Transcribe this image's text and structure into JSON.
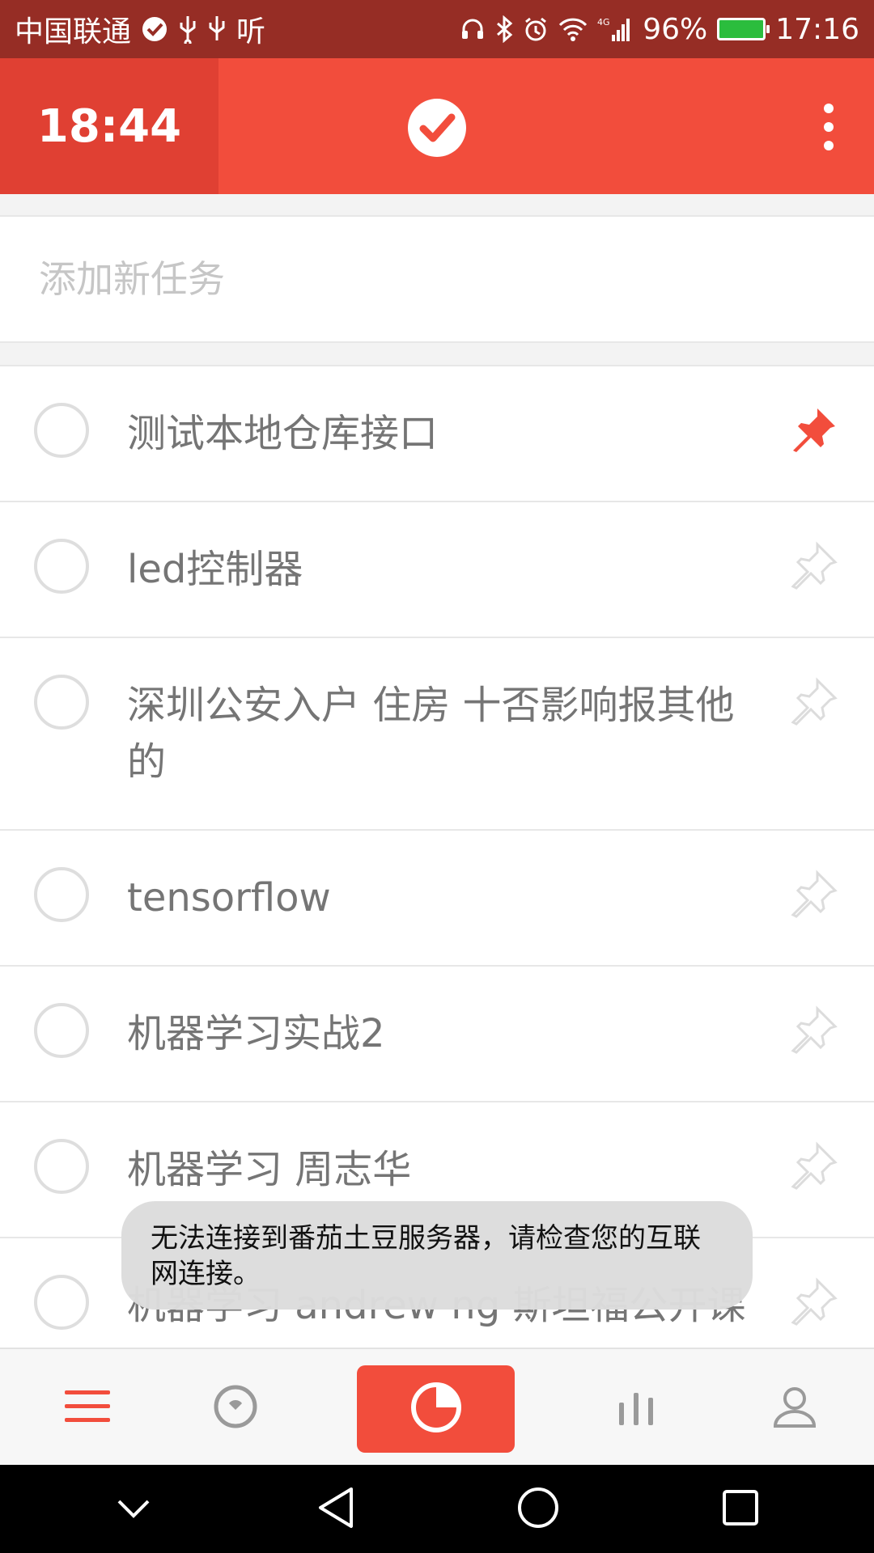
{
  "status_bar": {
    "carrier": "中国联通",
    "listen_label": "听",
    "network_type": "4G",
    "battery_percent": "96%",
    "time": "17:16"
  },
  "app_bar": {
    "timer": "18:44"
  },
  "add_task": {
    "placeholder": "添加新任务"
  },
  "tasks": [
    {
      "title": "测试本地仓库接口",
      "pinned": true
    },
    {
      "title": "led控制器",
      "pinned": false
    },
    {
      "title": "深圳公安入户 住房  十否影响报其他的",
      "pinned": false
    },
    {
      "title": "tensorflow",
      "pinned": false
    },
    {
      "title": "机器学习实战2",
      "pinned": false
    },
    {
      "title": "机器学习 周志华",
      "pinned": false
    },
    {
      "title": "机器学习 andrew ng 斯坦福公开课",
      "pinned": false
    }
  ],
  "toast": {
    "message": "无法连接到番茄土豆服务器，请检查您的互联网连接。"
  },
  "tabbar": {
    "tabs": [
      "list-icon",
      "focus-icon",
      "pomodoro-icon",
      "stats-icon",
      "profile-icon"
    ],
    "active_color": "#f24d3c"
  },
  "colors": {
    "brand": "#f24d3c",
    "brand_dark": "#e04033",
    "status_bar": "#962d25"
  }
}
